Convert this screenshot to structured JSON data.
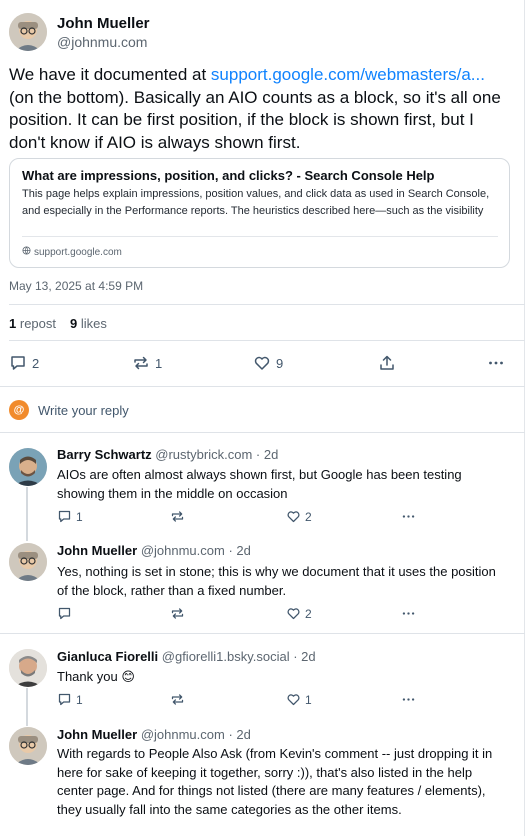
{
  "main_post": {
    "author_name": "John Mueller",
    "author_handle": "@johnmu.com",
    "text_prefix": "We have it documented at ",
    "link_text": "support.google.com/webmasters/a...",
    "text_suffix": " (on the bottom). Basically an AIO counts as a block, so it's all one position. It can be first position, if the block is shown first, but I don't know if AIO is always shown first.",
    "card": {
      "title": "What are impressions, position, and clicks? - Search Console Help",
      "description": "This page helps explain impressions, position values, and click data as used in Search Console, and especially in the Performance reports. The heuristics described here—such as the visibility requ",
      "domain": "support.google.com"
    },
    "timestamp": "May 13, 2025 at 4:59 PM",
    "reposts_count": "1",
    "reposts_label": "repost",
    "likes_count": "9",
    "likes_label": "likes",
    "actions": {
      "replies": "2",
      "reposts": "1",
      "likes": "9"
    }
  },
  "reply_prompt": "Write your reply",
  "replies": [
    {
      "author_name": "Barry Schwartz",
      "author_handle": "@rustybrick.com",
      "age": "· 2d",
      "text": "AIOs are often almost always shown first, but Google has been testing showing them in the middle on occasion",
      "replies": "1",
      "reposts": "",
      "likes": "2"
    },
    {
      "author_name": "John Mueller",
      "author_handle": "@johnmu.com",
      "age": "· 2d",
      "text": "Yes, nothing is set in stone; this is why we document that it uses the position of the block, rather than a fixed number.",
      "replies": "",
      "reposts": "",
      "likes": "2"
    },
    {
      "author_name": "Gianluca Fiorelli",
      "author_handle": "@gfiorelli1.bsky.social",
      "age": "· 2d",
      "text": "Thank you 😊",
      "replies": "1",
      "reposts": "",
      "likes": "1"
    },
    {
      "author_name": "John Mueller",
      "author_handle": "@johnmu.com",
      "age": "· 2d",
      "text": "With regards to People Also Ask (from Kevin's comment -- just dropping it in here for sake of keeping it together, sorry :)), that's also listed in the help center page. And for things not listed (there are many features / elements), they usually fall into the same categories as the other items.",
      "replies": "",
      "reposts": "",
      "likes": ""
    }
  ],
  "icons": {
    "reply": "reply-icon",
    "repost": "repost-icon",
    "like": "heart-icon",
    "share": "share-icon",
    "more": "more-icon",
    "globe": "globe-icon",
    "compose": "at-icon"
  },
  "colors": {
    "accent": "#1083fe",
    "text": "#0b0f14",
    "muted": "#5c6670",
    "compose_badge": "#f18b2c"
  }
}
